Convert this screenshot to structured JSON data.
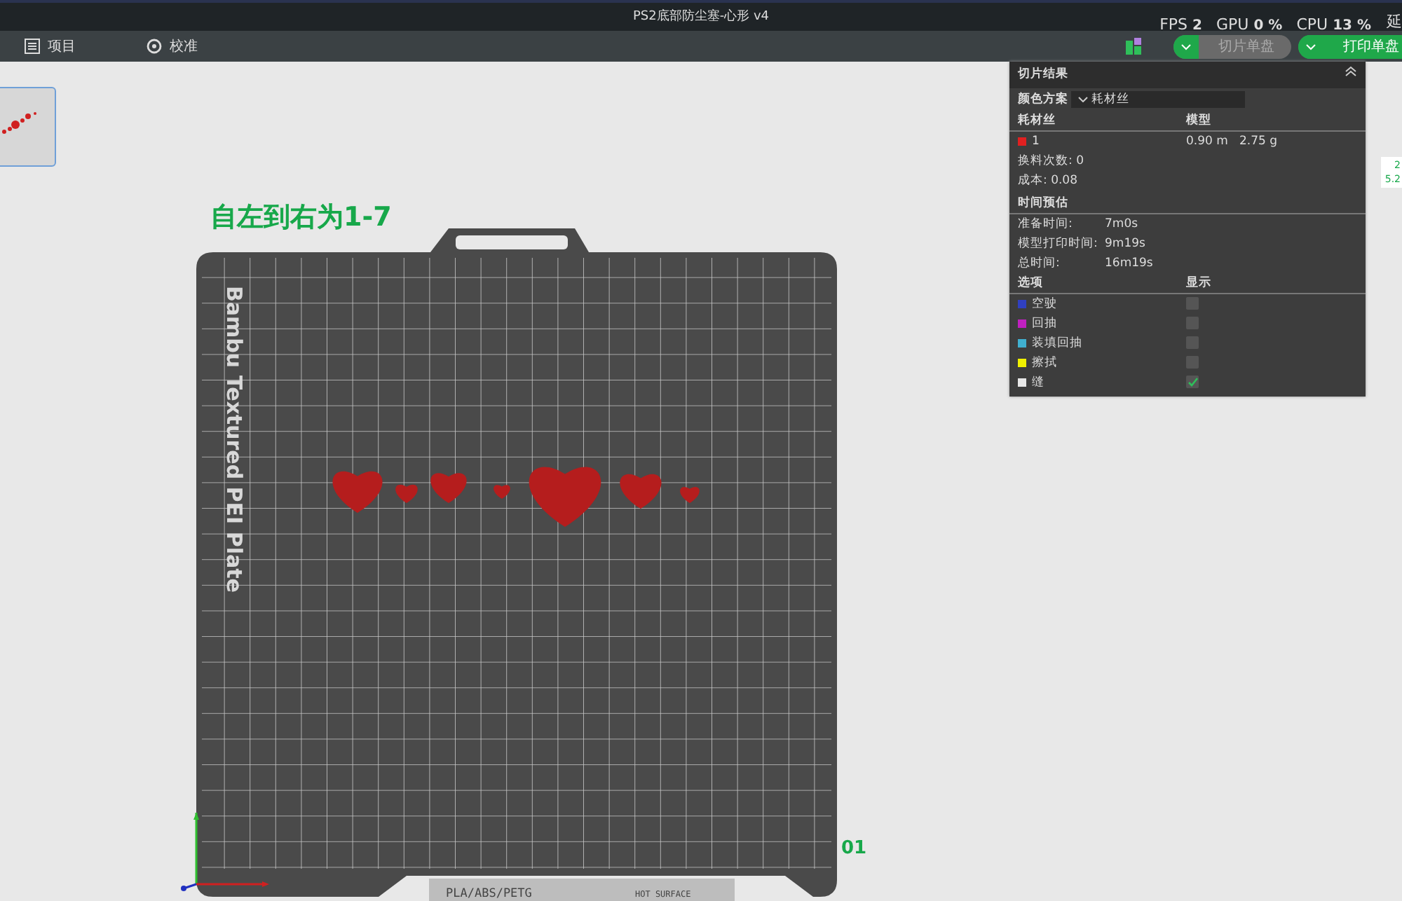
{
  "window": {
    "title": "PS2底部防尘塞-心形 v4",
    "corner_text": "延"
  },
  "toolbar": {
    "items": [
      {
        "kind": "list",
        "label": "项目"
      },
      {
        "kind": "gear",
        "label": "校准"
      }
    ],
    "buttons": [
      {
        "label": "切片单盘",
        "disabled": true
      },
      {
        "label": "打印单盘",
        "disabled": false
      }
    ]
  },
  "stats": [
    {
      "label": "FPS",
      "value": "2"
    },
    {
      "label": "GPU",
      "value": "0 %"
    },
    {
      "label": "CPU",
      "value": "13 %"
    }
  ],
  "canvas": {
    "annotation": "自左到右为1-7",
    "plate_name": "Bambu Textured PEI Plate",
    "plate_materials": "PLA/ABS/PETG",
    "plate_warning": "HOT SURFACE",
    "plate_number": "01",
    "edge_labels": [
      "2",
      "5.2"
    ]
  },
  "thumbnails": [
    {
      "selected": true
    }
  ],
  "slice_panel": {
    "title": "切片结果",
    "color_scheme_label": "颜色方案",
    "color_scheme": "耗材丝",
    "filament_header": [
      "耗材丝",
      "模型"
    ],
    "filaments": [
      {
        "name": "1",
        "color": "#e02020",
        "length": "0.90 m",
        "weight": "2.75 g"
      }
    ],
    "filament_stats": [
      {
        "label": "换料次数:",
        "value": "0"
      },
      {
        "label": "成本:",
        "value": "0.08"
      }
    ],
    "time_title": "时间预估",
    "times": [
      {
        "label": "准备时间:",
        "value": "7m0s"
      },
      {
        "label": "模型打印时间:",
        "value": "9m19s"
      },
      {
        "label": "总时间:",
        "value": "16m19s"
      }
    ],
    "options_header": [
      "选项",
      "显示"
    ],
    "options": [
      {
        "name": "空驶",
        "color": "#3040c0",
        "checked": false
      },
      {
        "name": "回抽",
        "color": "#c020c0",
        "checked": false
      },
      {
        "name": "装填回抽",
        "color": "#40b0d0",
        "checked": false
      },
      {
        "name": "擦拭",
        "color": "#f0f000",
        "checked": false
      },
      {
        "name": "缝",
        "color": "#e8e8e8",
        "checked": true
      }
    ]
  }
}
